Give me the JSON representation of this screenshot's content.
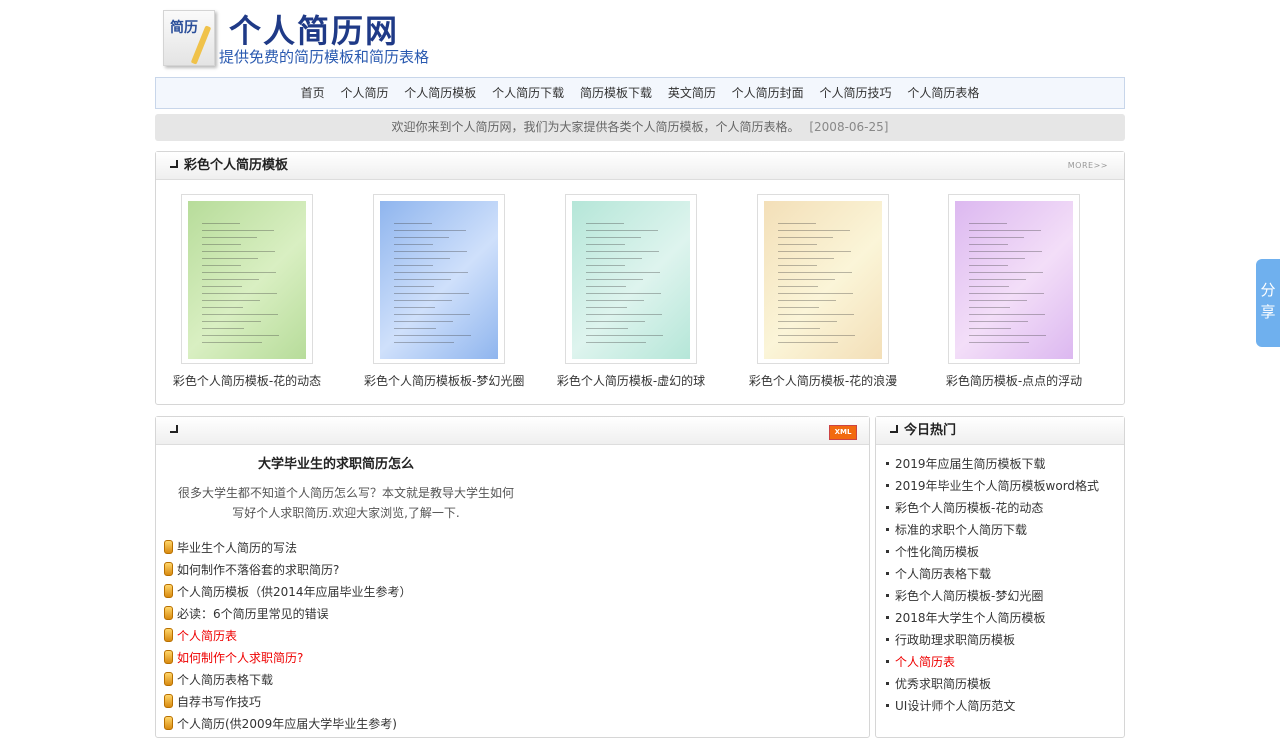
{
  "header": {
    "logo_icon_text": "简历",
    "title": "个人简历网",
    "subtitle": "提供免费的简历模板和简历表格"
  },
  "nav": [
    "首页",
    "个人简历",
    "个人简历模板",
    "个人简历下载",
    "简历模板下载",
    "英文简历",
    "个人简历封面",
    "个人简历技巧",
    "个人简历表格"
  ],
  "notice": {
    "text": "欢迎你来到个人简历网，我们为大家提供各类个人简历模板，个人简历表格。",
    "date": "[2008-06-25]"
  },
  "color_panel": {
    "title": "彩色个人简历模板",
    "more": "MORE>>",
    "items": [
      {
        "caption": "彩色个人简历模板-花的动态",
        "color": "#d9efc2",
        "color2": "#b7dc9a"
      },
      {
        "caption": "彩色个人简历模板板-梦幻光圈",
        "color": "#cfe0fb",
        "color2": "#8fb5ee"
      },
      {
        "caption": "彩色个人简历模板-虚幻的球",
        "color": "#def4ee",
        "color2": "#b5e6d8"
      },
      {
        "caption": "彩色个人简历模板-花的浪漫",
        "color": "#fbf5d8",
        "color2": "#f3dfb8"
      },
      {
        "caption": "彩色简历模板-点点的浮动",
        "color": "#f3def8",
        "color2": "#dcb8f0"
      }
    ]
  },
  "article": {
    "xml_badge": "XML",
    "title": "大学毕业生的求职简历怎么",
    "desc_line1": "很多大学生都不知道个人简历怎么写？本文就是教导大学生如何",
    "desc_line2": "写好个人求职简历.欢迎大家浏览,了解一下.",
    "links": [
      {
        "text": "毕业生个人简历的写法",
        "red": false
      },
      {
        "text": "如何制作不落俗套的求职简历?",
        "red": false
      },
      {
        "text": "个人简历模板（供2014年应届毕业生参考）",
        "red": false
      },
      {
        "text": "必读：6个简历里常见的错误",
        "red": false
      },
      {
        "text": "个人简历表",
        "red": true
      },
      {
        "text": "如何制作个人求职简历?",
        "red": true
      },
      {
        "text": "个人简历表格下载",
        "red": false
      },
      {
        "text": "自荐书写作技巧",
        "red": false
      },
      {
        "text": "个人简历(供2009年应届大学毕业生参考)",
        "red": false
      }
    ]
  },
  "hot": {
    "title": "今日热门",
    "items": [
      {
        "text": "2019年应届生简历模板下载",
        "red": false
      },
      {
        "text": "2019年毕业生个人简历模板word格式",
        "red": false
      },
      {
        "text": "彩色个人简历模板-花的动态",
        "red": false
      },
      {
        "text": "标准的求职个人简历下载",
        "red": false
      },
      {
        "text": "个性化简历模板",
        "red": false
      },
      {
        "text": "个人简历表格下载",
        "red": false
      },
      {
        "text": "彩色个人简历模板-梦幻光圈",
        "red": false
      },
      {
        "text": "2018年大学生个人简历模板",
        "red": false
      },
      {
        "text": "行政助理求职简历模板",
        "red": false
      },
      {
        "text": "个人简历表",
        "red": true
      },
      {
        "text": "优秀求职简历模板",
        "red": false
      },
      {
        "text": "UI设计师个人简历范文",
        "red": false
      }
    ]
  },
  "share": {
    "line1": "分",
    "line2": "享"
  }
}
